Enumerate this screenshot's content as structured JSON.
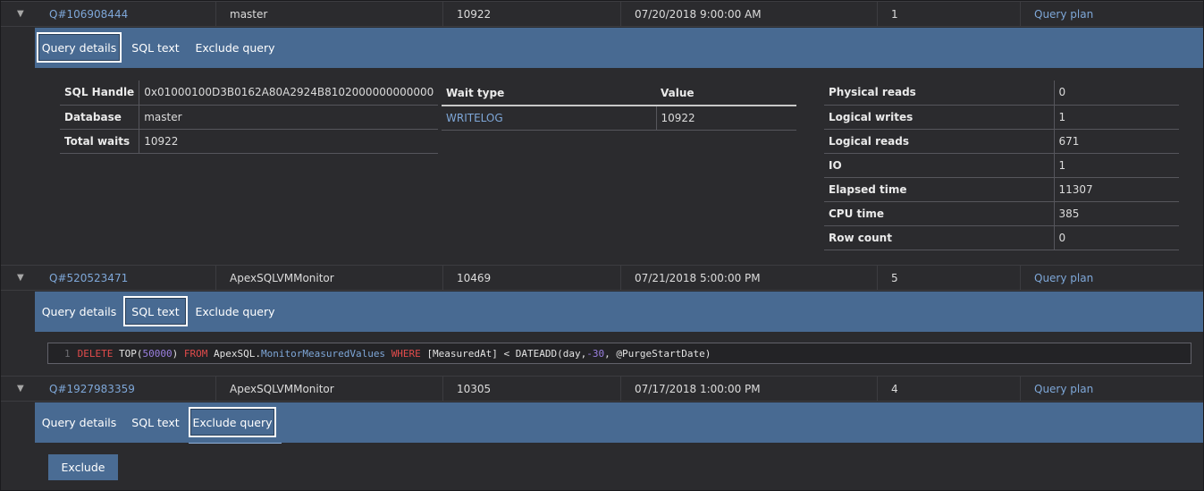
{
  "rows": [
    {
      "query_id": "Q#106908444",
      "database": "master",
      "total_waits": "10922",
      "time": "07/20/2018 9:00:00 AM",
      "count": "1",
      "plan_link": "Query plan"
    },
    {
      "query_id": "Q#520523471",
      "database": "ApexSQLVMMonitor",
      "total_waits": "10469",
      "time": "07/21/2018 5:00:00 PM",
      "count": "5",
      "plan_link": "Query plan"
    },
    {
      "query_id": "Q#1927983359",
      "database": "ApexSQLVMMonitor",
      "total_waits": "10305",
      "time": "07/17/2018 1:00:00 PM",
      "count": "4",
      "plan_link": "Query plan"
    }
  ],
  "tabs": {
    "details": "Query details",
    "sql": "SQL text",
    "exclude": "Exclude query"
  },
  "details": {
    "left": [
      {
        "key": "SQL Handle",
        "value": "0x01000100D3B0162A80A2924B8102000000000000"
      },
      {
        "key": "Database",
        "value": "master"
      },
      {
        "key": "Total waits",
        "value": "10922"
      }
    ],
    "wait_table": {
      "headers": [
        "Wait type",
        "Value"
      ],
      "rows": [
        {
          "type": "WRITELOG",
          "value": "10922"
        }
      ]
    },
    "right": [
      {
        "key": "Physical reads",
        "value": "0"
      },
      {
        "key": "Logical writes",
        "value": "1"
      },
      {
        "key": "Logical reads",
        "value": "671"
      },
      {
        "key": "IO",
        "value": "1"
      },
      {
        "key": "Elapsed time",
        "value": "11307"
      },
      {
        "key": "CPU time",
        "value": "385"
      },
      {
        "key": "Row count",
        "value": "0"
      }
    ]
  },
  "sql_code": {
    "line_number": "1",
    "tokens": {
      "delete": "DELETE",
      "top": "TOP(",
      "top_num": "50000",
      "close_paren": ")",
      "from": "FROM",
      "schema": "ApexSQL.",
      "object": "MonitorMeasuredValues",
      "where": "WHERE",
      "column": "[MeasuredAt] < DATEADD(day, ",
      "neg_num": "-30",
      "tail": ", @PurgeStartDate)"
    }
  },
  "exclude_button": "Exclude"
}
